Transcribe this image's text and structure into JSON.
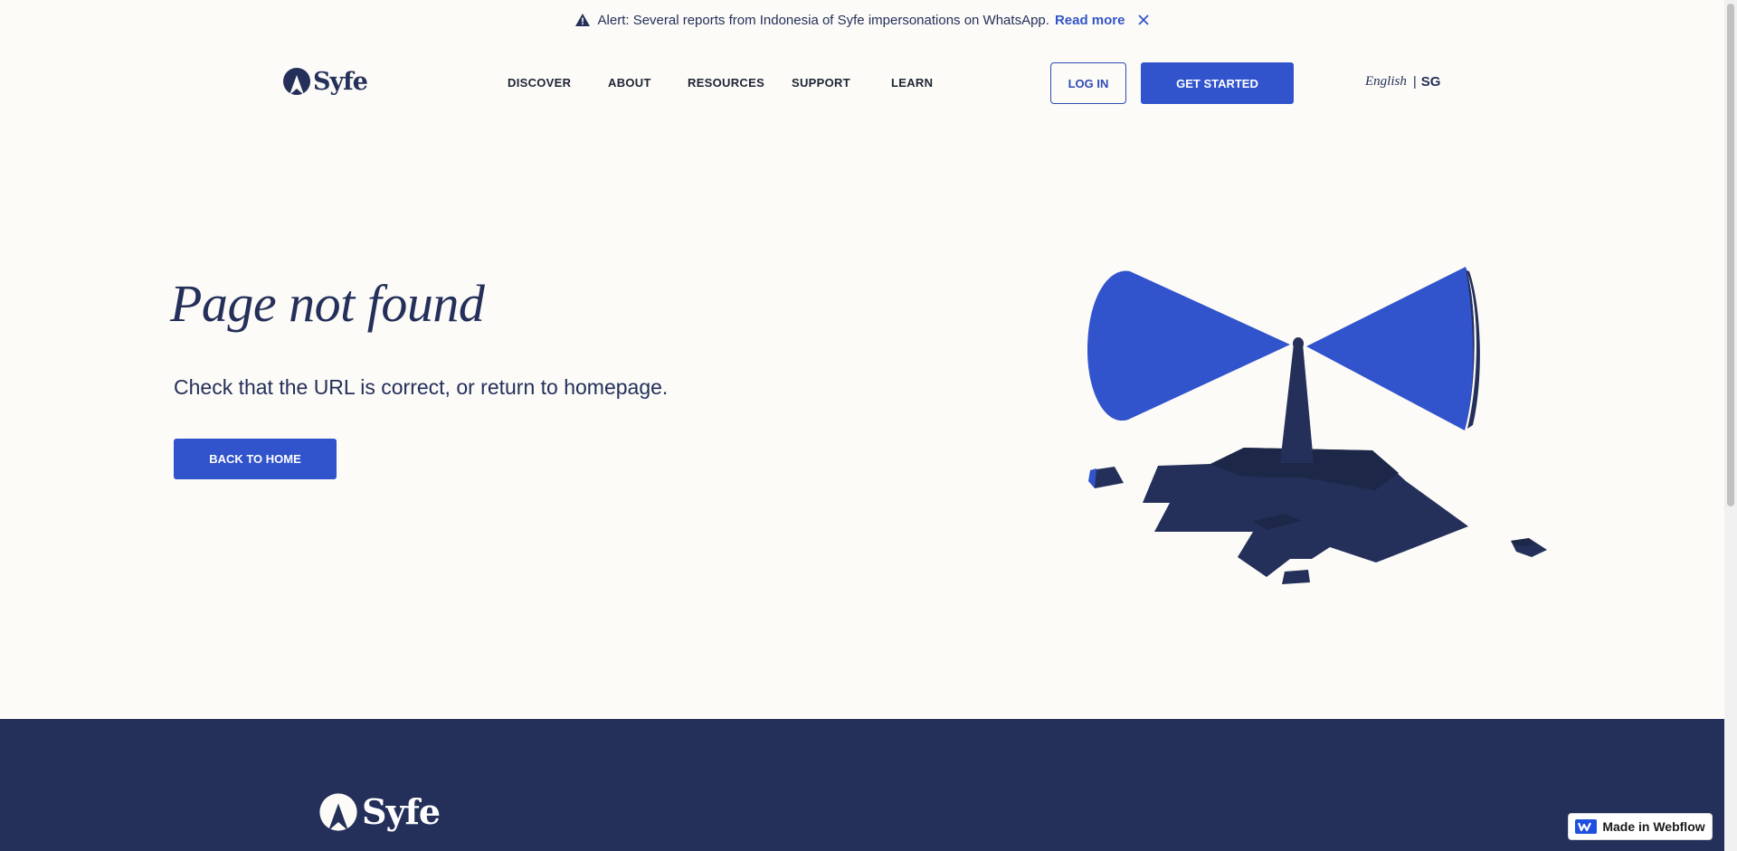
{
  "alert": {
    "message": "Alert: Several reports from Indonesia of Syfe impersonations on WhatsApp.",
    "link_label": "Read more"
  },
  "header": {
    "logo_text": "Syfe",
    "nav": [
      "DISCOVER",
      "ABOUT",
      "RESOURCES",
      "SUPPORT",
      "LEARN"
    ],
    "login_label": "LOG IN",
    "get_started_label": "GET STARTED",
    "language": "English",
    "separator": "|",
    "region": "SG"
  },
  "main": {
    "title": "Page not found",
    "subtitle": "Check that the URL is correct, or return to homepage.",
    "back_label": "BACK TO HOME"
  },
  "footer": {
    "logo_text": "Syfe"
  },
  "badge": {
    "label": "Made in Webflow"
  },
  "colors": {
    "brand_blue": "#3153cc",
    "navy": "#24305a",
    "background": "#fcfbf8"
  }
}
